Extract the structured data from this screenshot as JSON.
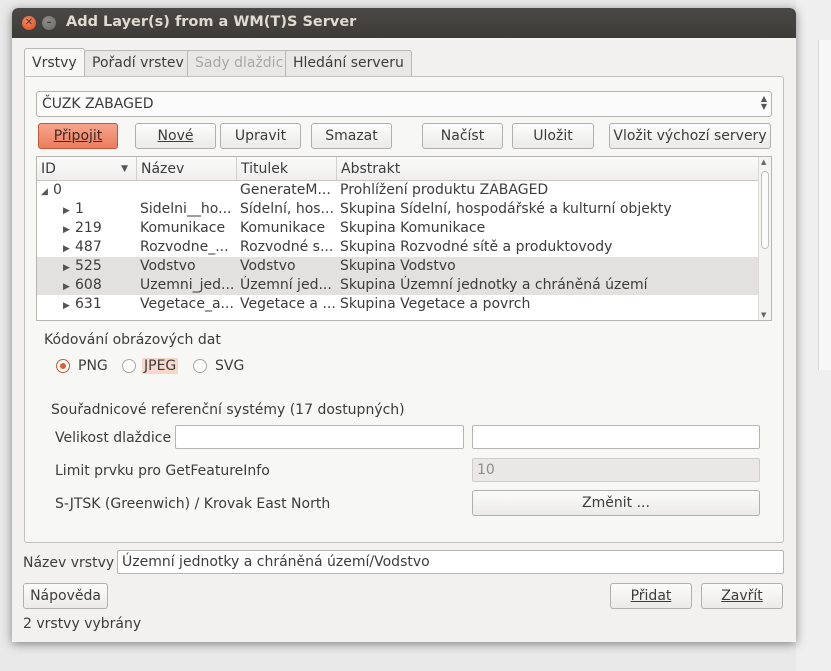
{
  "window": {
    "title": "Add Layer(s) from a WM(T)S Server",
    "close_glyph": "✕",
    "min_glyph": "–"
  },
  "tabs": [
    {
      "label": "Vrstvy",
      "active": true
    },
    {
      "label": "Pořadí vrstev",
      "active": false
    },
    {
      "label": "Sady dlaždic",
      "active": false,
      "disabled": true
    },
    {
      "label": "Hledání serveru",
      "active": false
    }
  ],
  "server_combo": {
    "value": "ČUZK ZABAGED",
    "arrows": "▲\n▼"
  },
  "buttons": {
    "connect": "Připojit",
    "new": "Nové",
    "edit": "Upravit",
    "delete": "Smazat",
    "load": "Načíst",
    "save": "Uložit",
    "add_default": "Vložit výchozí servery",
    "change": "Změnit ...",
    "help": "Nápověda",
    "add": "Přidat",
    "close": "Zavřít"
  },
  "tree": {
    "columns": [
      "ID",
      "Název",
      "Titulek",
      "Abstrakt"
    ],
    "sort_glyph": "▼",
    "expanded_glyph": "◢",
    "collapsed_glyph": "▶",
    "rows": [
      {
        "id": "0",
        "expanded": true,
        "level": 0,
        "name": "",
        "title": "GenerateM...",
        "abstract": "Prohlížení produktu ZABAGED",
        "selected": false
      },
      {
        "id": "1",
        "expanded": false,
        "level": 1,
        "name": "Sidelni__ho...",
        "title": "Sídelní, hos...",
        "abstract": "Skupina Sídelní, hospodářské a kulturní objekty",
        "selected": false
      },
      {
        "id": "219",
        "expanded": false,
        "level": 1,
        "name": "Komunikace",
        "title": "Komunikace",
        "abstract": "Skupina Komunikace",
        "selected": false
      },
      {
        "id": "487",
        "expanded": false,
        "level": 1,
        "name": "Rozvodne_...",
        "title": "Rozvodné s...",
        "abstract": "Skupina Rozvodné sítě a produktovody",
        "selected": false
      },
      {
        "id": "525",
        "expanded": false,
        "level": 1,
        "name": "Vodstvo",
        "title": "Vodstvo",
        "abstract": "Skupina Vodstvo",
        "selected": true
      },
      {
        "id": "608",
        "expanded": false,
        "level": 1,
        "name": "Uzemni_jed...",
        "title": "Územní jed...",
        "abstract": "Skupina Územní jednotky a chráněná území",
        "selected": true
      },
      {
        "id": "631",
        "expanded": false,
        "level": 1,
        "name": "Vegetace_a...",
        "title": "Vegetace a ...",
        "abstract": "Skupina Vegetace a povrch",
        "selected": false
      }
    ]
  },
  "encoding": {
    "label": "Kódování obrázových dat",
    "options": [
      {
        "label": "PNG",
        "checked": true
      },
      {
        "label": "JPEG",
        "checked": false,
        "highlight": true
      },
      {
        "label": "SVG",
        "checked": false
      }
    ]
  },
  "crs": {
    "summary": "Souřadnicové referenční systémy  (17 dostupných)",
    "tile_size_label": "Velikost dlaždice",
    "tile_width_value": "",
    "tile_height_value": "",
    "feature_limit_label": "Limit prvku pro GetFeatureInfo",
    "feature_limit_value": "10",
    "selected_crs": "S-JTSK (Greenwich) / Krovak East North"
  },
  "layer_name": {
    "label": "Název vrstvy",
    "value": "Územní jednotky a chráněná území/Vodstvo"
  },
  "status": "2 vrstvy vybrány"
}
